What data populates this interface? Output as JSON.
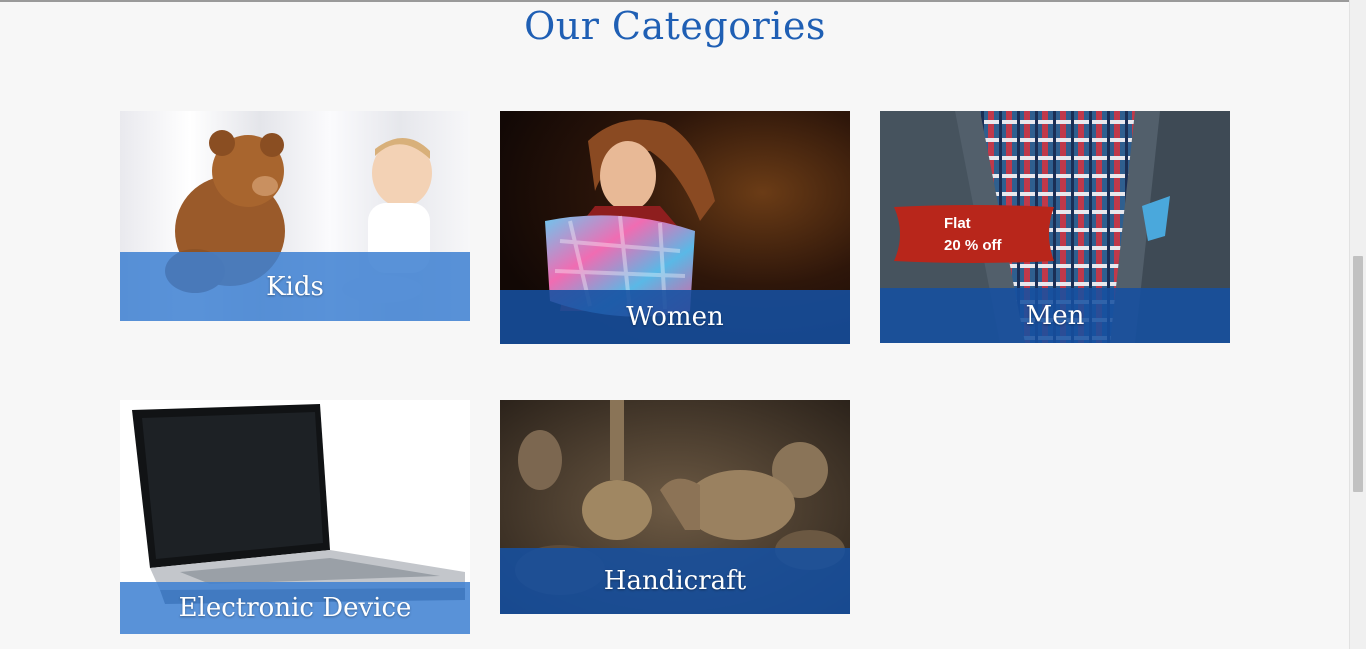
{
  "section": {
    "title": "Our Categories"
  },
  "categories": [
    {
      "label": "Kids"
    },
    {
      "label": "Women"
    },
    {
      "label": "Men",
      "promo": {
        "line1": "Flat",
        "line2": "20 % off"
      }
    },
    {
      "label": "Electronic Device"
    },
    {
      "label": "Handicraft"
    }
  ],
  "colors": {
    "title": "#1f5fb4",
    "band_light": "#3e80d2",
    "band_dark": "#1650a0",
    "promo": "#b8261b"
  },
  "icons": [
    "teddy-bear-baby-photo",
    "woman-scarf-photo",
    "men-jacket-photo",
    "laptop-photo",
    "brass-handicraft-photo"
  ]
}
